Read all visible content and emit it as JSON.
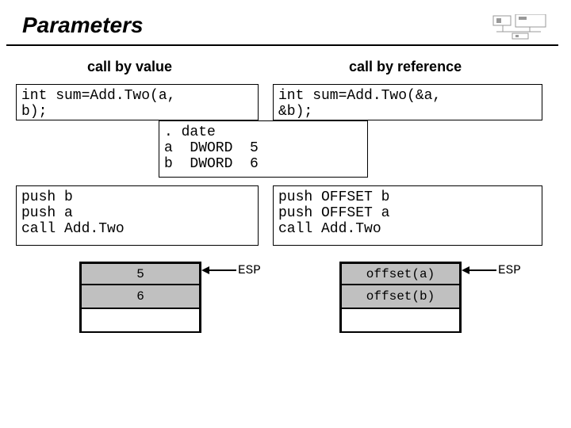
{
  "title": "Parameters",
  "headings": {
    "left": "call by value",
    "right": "call by reference"
  },
  "src": {
    "left": "int sum=Add.Two(a,\nb);",
    "right": "int sum=Add.Two(&a,\n&b);"
  },
  "data_decl": ". date\na  DWORD  5\nb  DWORD  6",
  "asm": {
    "left": "push b\npush a\ncall Add.Two",
    "right": "push OFFSET b\npush OFFSET a\ncall Add.Two"
  },
  "stack": {
    "left": [
      "5",
      "6",
      ""
    ],
    "right": [
      "offset(a)",
      "offset(b)",
      ""
    ]
  },
  "esp_label": "ESP"
}
